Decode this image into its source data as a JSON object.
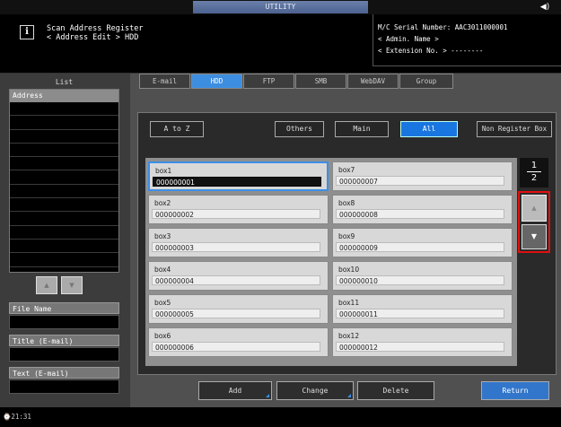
{
  "app": {
    "mode_title": "UTILITY",
    "speaker_icon": "speaker-icon",
    "title_line1": "Scan Address Register",
    "title_line2": "< Address Edit > HDD"
  },
  "machine": {
    "serial": "M/C Serial Number: AAC3011000001",
    "admin": "< Admin. Name >",
    "extension": "< Extension No. >   --------"
  },
  "left": {
    "list_title": "List",
    "address_header": "Address",
    "scroll_up": "▲",
    "scroll_down": "▼",
    "file_name_label": "File Name",
    "title_label": "Title (E-mail)",
    "text_label": "Text (E-mail)"
  },
  "tabs": [
    {
      "label": "E-mail"
    },
    {
      "label": "HDD",
      "active": true
    },
    {
      "label": "FTP"
    },
    {
      "label": "SMB"
    },
    {
      "label": "WebDAV"
    },
    {
      "label": "Group"
    }
  ],
  "filters": {
    "a_to_z": "A to Z",
    "others": "Others",
    "main": "Main",
    "all": "All",
    "non_register": "Non Register Box"
  },
  "boxes": [
    {
      "name": "box1",
      "number": "000000001",
      "selected": true
    },
    {
      "name": "box2",
      "number": "000000002"
    },
    {
      "name": "box3",
      "number": "000000003"
    },
    {
      "name": "box4",
      "number": "000000004"
    },
    {
      "name": "box5",
      "number": "000000005"
    },
    {
      "name": "box6",
      "number": "000000006"
    },
    {
      "name": "box7",
      "number": "000000007"
    },
    {
      "name": "box8",
      "number": "000000008"
    },
    {
      "name": "box9",
      "number": "000000009"
    },
    {
      "name": "box10",
      "number": "000000010"
    },
    {
      "name": "box11",
      "number": "000000011"
    },
    {
      "name": "box12",
      "number": "000000012"
    }
  ],
  "pagination": {
    "current": "1",
    "total": "2",
    "up": "▲",
    "down": "▼"
  },
  "actions": {
    "add": "Add",
    "change": "Change",
    "delete": "Delete",
    "return": "Return"
  },
  "footer": {
    "clock": "21:31"
  },
  "colors": {
    "accent": "#1976e0",
    "highlight": "#e01010"
  }
}
